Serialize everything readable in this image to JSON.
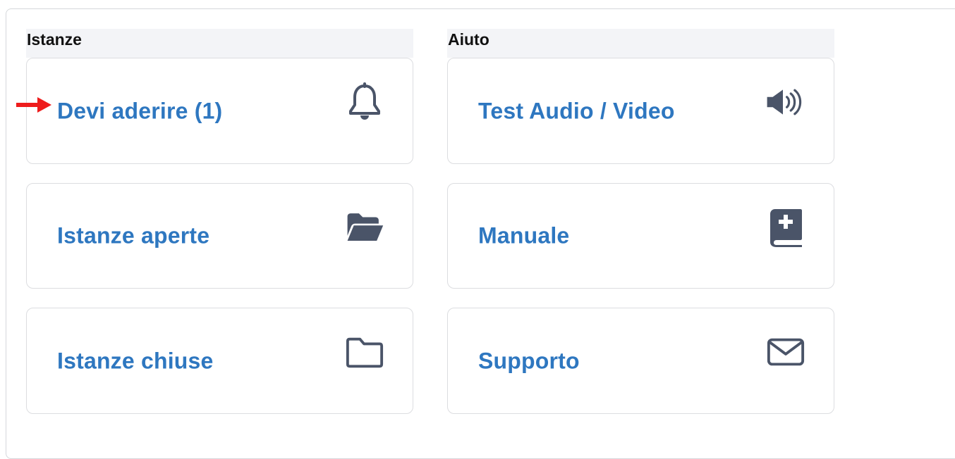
{
  "sections": [
    {
      "title": "Istanze",
      "cards": [
        {
          "label": "Devi aderire (1)",
          "icon": "bell-icon"
        },
        {
          "label": "Istanze aperte",
          "icon": "folder-open-icon"
        },
        {
          "label": "Istanze chiuse",
          "icon": "folder-icon"
        }
      ]
    },
    {
      "title": "Aiuto",
      "cards": [
        {
          "label": "Test Audio / Video",
          "icon": "volume-icon"
        },
        {
          "label": "Manuale",
          "icon": "medical-book-icon"
        },
        {
          "label": "Supporto",
          "icon": "envelope-icon"
        }
      ]
    }
  ],
  "colors": {
    "link": "#2e77c0",
    "icon": "#4a5468",
    "arrow": "#ee1c1c",
    "header_bg": "#f3f4f7"
  }
}
